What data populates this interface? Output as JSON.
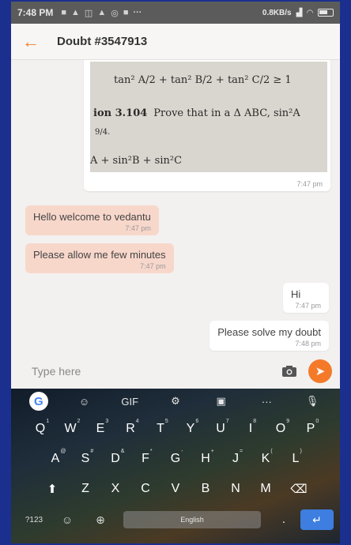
{
  "status_bar": {
    "time": "7:48 PM",
    "network_speed": "0.8KB/s",
    "icons": [
      "notification-icon",
      "wifi-icon",
      "signal-icon",
      "battery-icon"
    ]
  },
  "header": {
    "back_icon": "arrow-left-icon",
    "title": "Doubt #3547913"
  },
  "messages": [
    {
      "type": "image",
      "direction": "out",
      "image_text": {
        "line1": "tan² A/2 + tan² B/2 + tan² C/2 ≥ 1",
        "line2_label": "ion 3.104",
        "line2": "Prove that in a Δ ABC, sin²A",
        "line3": "9/4.",
        "line4": "A + sin²B + sin²C"
      },
      "time": "7:47 pm"
    },
    {
      "type": "text",
      "direction": "in",
      "text": "Hello welcome to vedantu",
      "time": "7:47 pm"
    },
    {
      "type": "text",
      "direction": "in",
      "text": "Please allow me few minutes",
      "time": "7:47 pm"
    },
    {
      "type": "text",
      "direction": "out",
      "text": "Hi",
      "time": "7:47 pm"
    },
    {
      "type": "text",
      "direction": "out",
      "text": "Please solve my doubt",
      "time": "7:48 pm"
    }
  ],
  "composer": {
    "placeholder": "Type here",
    "camera_icon": "camera-icon",
    "send_icon": "send-icon"
  },
  "keyboard": {
    "toolbar": [
      "G",
      "sticker",
      "GIF",
      "settings",
      "translate",
      "more",
      "mic"
    ],
    "gif_label": "GIF",
    "more_label": "···",
    "row1": [
      [
        "Q",
        "1"
      ],
      [
        "W",
        "2"
      ],
      [
        "E",
        "3"
      ],
      [
        "R",
        "4"
      ],
      [
        "T",
        "5"
      ],
      [
        "Y",
        "6"
      ],
      [
        "U",
        "7"
      ],
      [
        "I",
        "8"
      ],
      [
        "O",
        "9"
      ],
      [
        "P",
        "0"
      ]
    ],
    "row2": [
      [
        "A",
        "@"
      ],
      [
        "S",
        "#"
      ],
      [
        "D",
        "&"
      ],
      [
        "F",
        "*"
      ],
      [
        "G",
        "-"
      ],
      [
        "H",
        "+"
      ],
      [
        "J",
        "="
      ],
      [
        "K",
        "("
      ],
      [
        "L",
        ")"
      ]
    ],
    "row3": [
      "Z",
      "X",
      "C",
      "V",
      "B",
      "N",
      "M"
    ],
    "symbols_label": "?123",
    "space_label": "English",
    "period_label": "."
  },
  "colors": {
    "accent": "#f47a2a",
    "incoming_bubble": "#f8d7cb",
    "outgoing_bubble": "#ffffff",
    "enter_key": "#3d7ee0"
  }
}
